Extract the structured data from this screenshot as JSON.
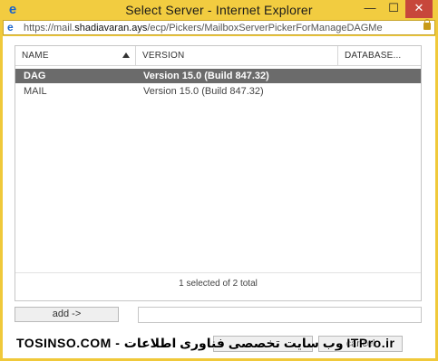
{
  "window": {
    "title": "Select Server - Internet Explorer",
    "minimize_glyph": "—",
    "maximize_glyph": "☐",
    "close_glyph": "✕"
  },
  "address": {
    "url_prefix": "https://mail.",
    "url_host": "shadiavaran.ays",
    "url_path": "/ecp/Pickers/MailboxServerPickerForManageDAGMe",
    "secure_icon": "lock-icon"
  },
  "grid": {
    "columns": [
      "NAME",
      "VERSION",
      "DATABASE..."
    ],
    "sort_icon": "sort-ascending-icon",
    "rows": [
      {
        "name": "DAG",
        "version": "Version 15.0 (Build 847.32)",
        "selected": true
      },
      {
        "name": "MAIL",
        "version": "Version 15.0 (Build 847.32)",
        "selected": false
      }
    ],
    "status": "1 selected of 2 total"
  },
  "controls": {
    "add_label": "add ->",
    "cancel_label": "cancel"
  },
  "watermark": "TOSINSO.COM - وب سایت تخصصی فناوری اطلاعات ITPro.ir",
  "colors": {
    "title_bar": "#f2cc40",
    "close_button": "#c7473b",
    "selected_row": "#6b6b6b"
  }
}
